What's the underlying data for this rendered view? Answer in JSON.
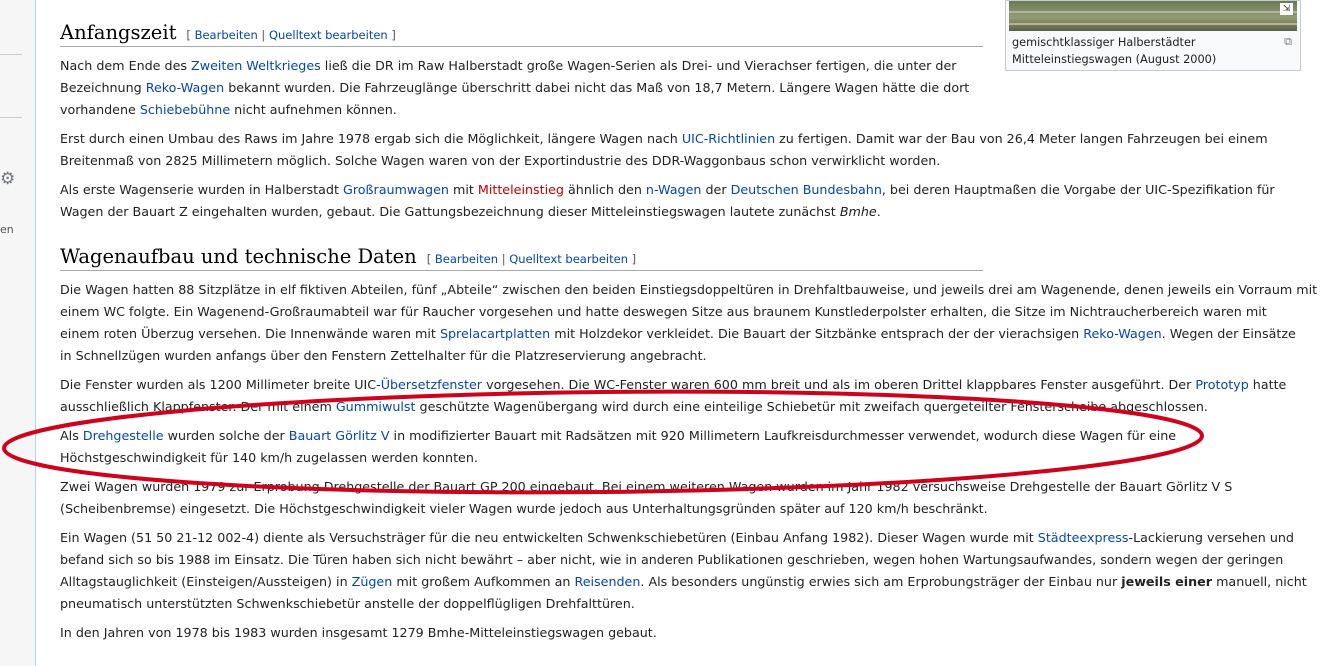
{
  "sidebar": {
    "gear_icon": "gear-icon",
    "partial_text": "en"
  },
  "thumb": {
    "caption_line1": "gemischtklassiger Halberstädter",
    "caption_line2": "Mitteleinstiegswagen (August 2000)",
    "enlarge_icon": "⧉",
    "magnify_icon": "⇲"
  },
  "section1": {
    "title": "Anfangszeit",
    "edit_open": "[ ",
    "edit": "Bearbeiten",
    "sep": " | ",
    "edit_source": "Quelltext bearbeiten",
    "edit_close": " ]"
  },
  "p1": {
    "t1": "Nach dem Ende des ",
    "l1": "Zweiten Weltkrieges",
    "t2": " ließ die DR im Raw Halberstadt große Wagen-Serien als Drei- und Vierachser fertigen, die unter der",
    "t3": "Bezeichnung ",
    "l2": "Reko-Wagen",
    "t4": " bekannt wurden. Die Fahrzeuglänge überschritt dabei nicht das Maß von 18,7 Metern. Längere Wagen hätte die dort",
    "t5": "vorhandene ",
    "l3": "Schiebebühne",
    "t6": " nicht aufnehmen können."
  },
  "p2": {
    "t1": "Erst durch einen Umbau des Raws im Jahre 1978 ergab sich die Möglichkeit, längere Wagen nach ",
    "l1": "UIC-Richtlinien",
    "t2": " zu fertigen. Damit war der Bau von 26,4 Meter langen Fahrzeugen bei einem",
    "t3": "Breitenmaß von 2825 Millimetern möglich. Solche Wagen waren von der Exportindustrie des DDR-Waggonbaus schon verwirklicht worden."
  },
  "p3": {
    "t1": "Als erste Wagenserie wurden in Halberstadt ",
    "l1": "Großraumwagen",
    "t2": " mit ",
    "l2": "Mitteleinstieg",
    "t3": " ähnlich den ",
    "l3": "n-Wagen",
    "t4": " der ",
    "l4": "Deutschen Bundesbahn",
    "t5": ", bei deren Hauptmaßen die Vorgabe der UIC-Spezifikation für",
    "t6": "Wagen der Bauart Z eingehalten wurden, gebaut. Die Gattungsbezeichnung dieser Mitteleinstiegswagen lautete zunächst ",
    "i1": "Bmhe",
    "t7": "."
  },
  "section2": {
    "title": "Wagenaufbau und technische Daten",
    "edit_open": "[ ",
    "edit": "Bearbeiten",
    "sep": " | ",
    "edit_source": "Quelltext bearbeiten",
    "edit_close": " ]"
  },
  "p4": {
    "t1": "Die Wagen hatten 88 Sitzplätze in elf fiktiven Abteilen, fünf „Abteile“ zwischen den beiden Einstiegsdoppeltüren in Drehfaltbauweise, und jeweils drei am Wagenende, denen jeweils ein Vorraum mit",
    "t2": "einem WC folgte. Ein Wagenend-Großraumabteil war für Raucher vorgesehen und hatte deswegen Sitze aus braunem Kunstlederpolster erhalten, die Sitze im Nichtraucherbereich waren mit",
    "t3": "einem roten Überzug versehen. Die Innenwände waren mit ",
    "l1": "Sprelacartplatten",
    "t4": " mit Holzdekor verkleidet. Die Bauart der Sitzbänke entsprach der der vierachsigen ",
    "l2": "Reko-Wagen",
    "t5": ". Wegen der Einsätze",
    "t6": "in Schnellzügen wurden anfangs über den Fenstern Zettelhalter für die Platzreservierung angebracht."
  },
  "p5": {
    "t1": "Die Fenster wurden als 1200 Millimeter breite UIC-",
    "l1": "Übersetzfenster",
    "t2": " vorgesehen. Die WC-Fenster waren 600 mm breit und als im oberen Drittel klappbares Fenster ausgeführt. Der ",
    "l2": "Prototyp",
    "t3": " hatte",
    "t4": "ausschließlich Klappfenster. Der mit einem ",
    "l3": "Gummiwulst",
    "t5": " geschützte Wagenübergang wird durch eine einteilige Schiebetür mit zweifach quergeteilter Fensterscheibe abgeschlossen."
  },
  "p6": {
    "t1": "Als ",
    "l1": "Drehgestelle",
    "t2": " wurden solche der ",
    "l2": "Bauart Görlitz V",
    "t3": " in modifizierter Bauart mit Radsätzen mit 920 Millimetern Laufkreisdurchmesser verwendet, wodurch diese Wagen für eine",
    "t4": "Höchstgeschwindigkeit für 140 km/h zugelassen werden konnten."
  },
  "p7": {
    "t1": "Zwei Wagen wurden 1979 zur Erprobung Drehgestelle der Bauart GP 200 eingebaut. Bei einem weiteren Wagen wurden im Jahr 1982 versuchsweise Drehgestelle der Bauart Görlitz V S",
    "t2": "(Scheibenbremse) eingesetzt. Die Höchstgeschwindigkeit vieler Wagen wurde jedoch aus Unterhaltungsgründen später auf 120 km/h beschränkt."
  },
  "p8": {
    "t1": "Ein Wagen (51 50 21-12 002-4) diente als Versuchsträger für die neu entwickelten Schwenkschiebetüren (Einbau Anfang 1982). Dieser Wagen wurde mit ",
    "l1": "Städteexpress",
    "t2": "-Lackierung versehen und",
    "t3": "befand sich so bis 1988 im Einsatz. Die Türen haben sich nicht bewährt – aber nicht, wie in anderen Publikationen geschrieben, wegen hohen Wartungsaufwandes, sondern wegen der geringen",
    "t4": "Alltagstauglichkeit (Einsteigen/Aussteigen) in ",
    "l2": "Zügen",
    "t5": " mit großem Aufkommen an ",
    "l3": "Reisenden",
    "t6": ". Als besonders ungünstig erwies sich am Erprobungsträger der Einbau nur ",
    "b1": "jeweils einer",
    "t7": " manuell, nicht",
    "t8": "pneumatisch unterstützten Schwenkschiebetür anstelle der doppelflügligen Drehfalttüren."
  },
  "p9": {
    "t1": "In den Jahren von 1978 bis 1983 wurden insgesamt 1279 Bmhe-Mitteleinstiegswagen gebaut."
  },
  "colors": {
    "link": "#0645ad",
    "redlink": "#ba0000",
    "annotation": "#d0021b",
    "border": "#a7d7f9"
  }
}
